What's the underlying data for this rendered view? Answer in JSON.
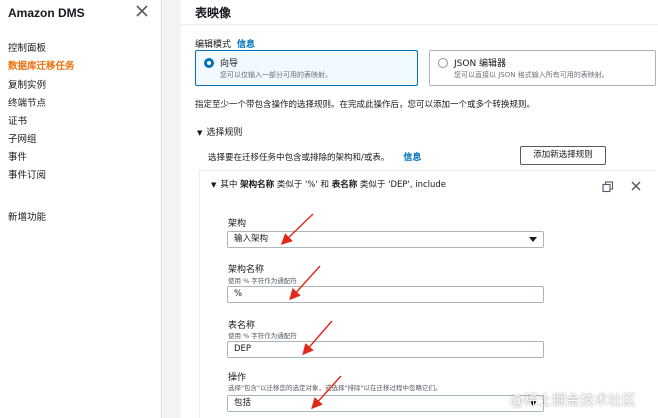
{
  "sidebar": {
    "title": "Amazon DMS",
    "items": [
      {
        "label": "控制面板",
        "active": false
      },
      {
        "label": "数据库迁移任务",
        "active": true
      },
      {
        "label": "复制实例",
        "active": false
      },
      {
        "label": "终端节点",
        "active": false
      },
      {
        "label": "证书",
        "active": false
      },
      {
        "label": "子网组",
        "active": false
      },
      {
        "label": "事件",
        "active": false
      },
      {
        "label": "事件订阅",
        "active": false
      }
    ],
    "new_features": "新增功能"
  },
  "main": {
    "title": "表映像",
    "edit_mode_label": "编辑模式",
    "info_link": "信息",
    "modes": [
      {
        "title": "向导",
        "desc": "您可以仅输入一部分可用的表映射。",
        "selected": true
      },
      {
        "title": "JSON 编辑器",
        "desc": "您可以直接以 JSON 格式输入所有可用的表映射。",
        "selected": false
      }
    ],
    "help_text": "指定至少一个带包含操作的选择规则。在完成此操作后，您可以添加一个或多个转换规则。",
    "selection_rules_heading": "选择规则",
    "selection_desc": "选择要在迁移任务中包含或排除的架构和/或表。",
    "selection_info": "信息",
    "add_rule_button": "添加新选择规则",
    "rule": {
      "prefix": "其中",
      "schema_key": "架构名称",
      "schema_like": "类似于 '%' 和",
      "table_key": "表名称",
      "table_like": "类似于 'DEP', include"
    },
    "fields": {
      "schema": {
        "label": "架构",
        "value": "输入架构"
      },
      "schema_name": {
        "label": "架构名称",
        "hint": "使用 % 字符作为通配符",
        "value": "%"
      },
      "table_name": {
        "label": "表名称",
        "hint": "使用 % 字符作为通配符",
        "value": "DEP"
      },
      "action": {
        "label": "操作",
        "hint": "选择\"包含\"以迁移您的选定对象，或选择\"排除\"以在迁移过程中忽略它们。",
        "value": "包括"
      }
    }
  },
  "watermark": "@稀土掘金技术社区",
  "colors": {
    "accent": "#ec7211",
    "link": "#0073bb",
    "annotation_arrow": "#e0291b"
  }
}
